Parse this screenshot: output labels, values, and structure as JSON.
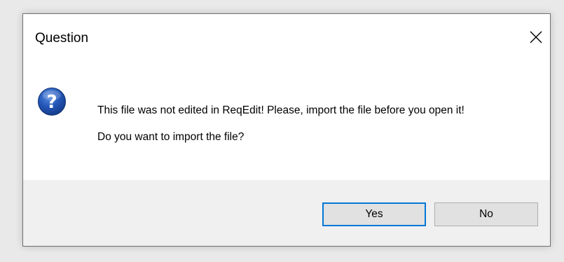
{
  "dialog": {
    "title": "Question",
    "icon": "question-icon",
    "message_line1": "This file was not edited in ReqEdit! Please, import the file before you open it!",
    "message_line2": "Do you want to import the file?",
    "buttons": {
      "yes_label": "Yes",
      "no_label": "No"
    },
    "colors": {
      "accent": "#0078d7",
      "button_bar": "#f0f0f0",
      "button_face": "#e1e1e1",
      "icon_blue": "#1b4fa8"
    }
  }
}
